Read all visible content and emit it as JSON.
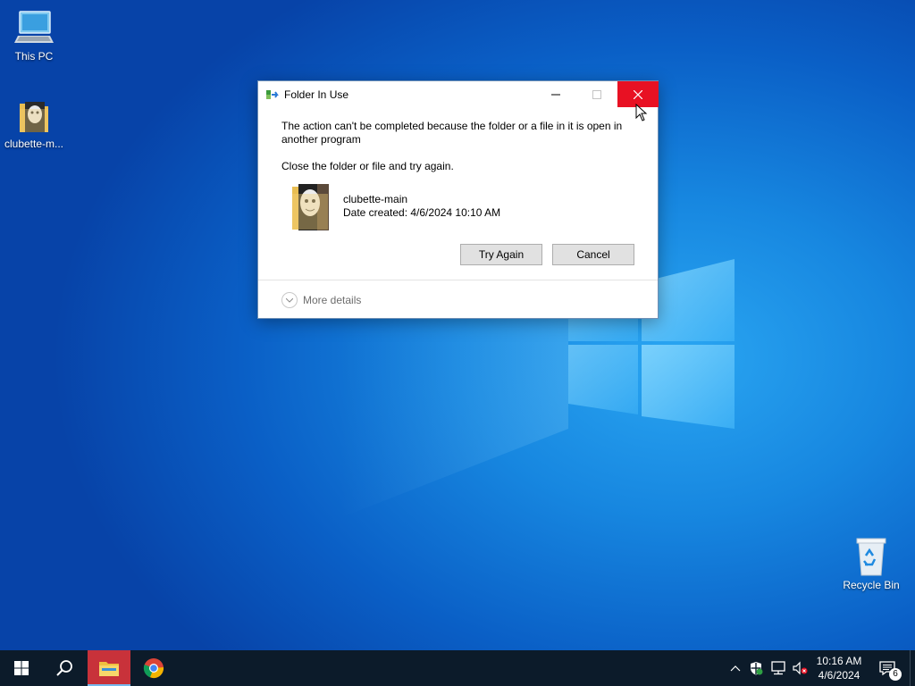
{
  "desktop": {
    "icons": [
      {
        "label": "This PC",
        "icon": "this-pc-icon"
      },
      {
        "label": "clubette-m...",
        "icon": "folder-icon"
      },
      {
        "label": "Recycle Bin",
        "icon": "recycle-bin-icon"
      }
    ]
  },
  "dialog": {
    "title": "Folder In Use",
    "message": "The action can't be completed because the folder or a file in it is open in another program",
    "instruction": "Close the folder or file and try again.",
    "file_name": "clubette-main",
    "file_date": "Date created: 4/6/2024 10:10 AM",
    "try_again_label": "Try Again",
    "cancel_label": "Cancel",
    "more_details_label": "More details",
    "close_hover_color": "#e81123"
  },
  "taskbar": {
    "items": [
      "start-icon",
      "search-icon",
      "file-explorer-icon",
      "chrome-icon"
    ],
    "tray_icons": [
      "chevron-up-icon",
      "security-icon",
      "network-icon",
      "volume-muted-icon"
    ],
    "time": "10:16 AM",
    "date": "4/6/2024",
    "notification_count": "6"
  }
}
